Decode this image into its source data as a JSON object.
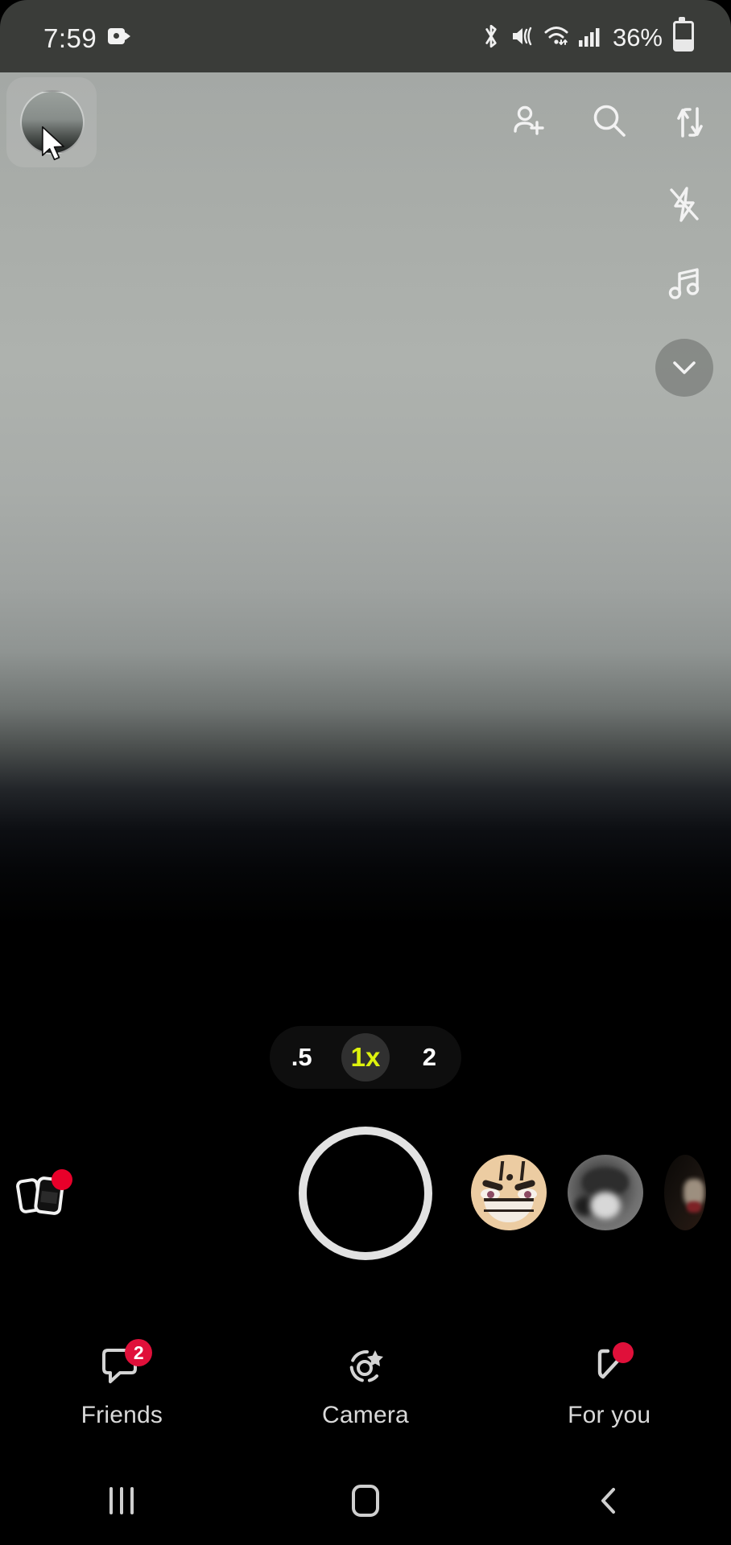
{
  "status_bar": {
    "time": "7:59",
    "recording_icon": "video-recording-icon",
    "bluetooth_icon": "bluetooth-icon",
    "sound_icon": "vibrate-icon",
    "wifi_icon": "wifi-icon",
    "signal_icon": "cellular-signal-icon",
    "battery_text": "36%",
    "battery_icon": "battery-icon"
  },
  "camera": {
    "profile_label": "profile-avatar",
    "top_actions": [
      {
        "name": "add-friend-icon",
        "label": "Add friend"
      },
      {
        "name": "search-icon",
        "label": "Search"
      },
      {
        "name": "flip-camera-icon",
        "label": "Flip camera"
      }
    ],
    "side_actions": [
      {
        "name": "flash-off-icon",
        "label": "Flash off"
      },
      {
        "name": "music-icon",
        "label": "Sounds"
      },
      {
        "name": "chevron-down-icon",
        "label": "More options"
      }
    ],
    "zoom": {
      "options": [
        {
          "value": ".5",
          "selected": false
        },
        {
          "value": "1x",
          "selected": true
        },
        {
          "value": "2",
          "selected": false
        }
      ],
      "selected": "1x",
      "accent_color": "#ddf20d"
    },
    "shutter_label": "Capture",
    "lenses": [
      {
        "name": "lens-anime-face",
        "label": "Anime face lens"
      },
      {
        "name": "lens-photo",
        "label": "Photo lens"
      },
      {
        "name": "lens-partial",
        "label": "More lenses"
      }
    ],
    "memories": {
      "label": "Memories",
      "has_badge": true
    }
  },
  "tabs": [
    {
      "key": "friends",
      "label": "Friends",
      "icon": "chat-bubble-icon",
      "badge": "2",
      "badge_type": "count"
    },
    {
      "key": "camera",
      "label": "Camera",
      "icon": "camera-lens-star-icon",
      "badge": "",
      "badge_type": "none"
    },
    {
      "key": "for-you",
      "label": "For you",
      "icon": "spotlight-play-icon",
      "badge": "",
      "badge_type": "dot"
    }
  ],
  "nav_bar": [
    {
      "name": "recents-button",
      "label": "Recents"
    },
    {
      "name": "home-button",
      "label": "Home"
    },
    {
      "name": "back-button",
      "label": "Back"
    }
  ],
  "colors": {
    "accent_yellow": "#ddf20d",
    "badge_red": "#e0103a",
    "status_bg": "#3a3c39"
  }
}
